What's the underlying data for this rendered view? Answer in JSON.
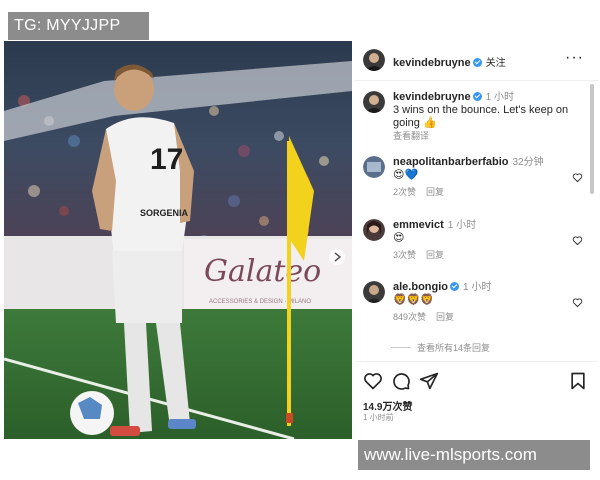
{
  "watermark_top": "TG: MYYJJPP",
  "watermark_bottom": "www.live-mlsports.com",
  "photo": {
    "jersey_number": "17",
    "sponsor_text": "SORGENIA",
    "banner_text": "Galateo",
    "banner_subtext": "ACCESSORIES & DESIGN · MILANO"
  },
  "post": {
    "username": "kevindebruyne",
    "follow_label": "关注",
    "more_label": "···",
    "caption_user": "kevindebruyne",
    "caption_time": "1 小时",
    "caption_text": "3 wins on the bounce. Let's keep on going",
    "caption_emoji": "👍",
    "see_translation": "查看翻译"
  },
  "comments": [
    {
      "user": "neapolitanbarberfabio",
      "time": "32分钟",
      "text": "😍💙",
      "likes": "2次赞",
      "reply": "回复"
    },
    {
      "user": "emmevict",
      "time": "1 小时",
      "text": "😍",
      "likes": "3次赞",
      "reply": "回复"
    },
    {
      "user": "ale.bongio",
      "time": "1 小时",
      "text": "🦁🦁🦁",
      "likes": "849次赞",
      "reply": "回复"
    }
  ],
  "view_all_replies": "查看所有14条回复",
  "likes_count": "14.9万次赞",
  "posted_time": "1 小时前",
  "icons": [
    "heart-icon",
    "comment-icon",
    "share-icon",
    "bookmark-icon",
    "more-icon",
    "verified-icon"
  ],
  "colors": {
    "verified": "#3897f0",
    "watermark_bg": "#8c8c8c",
    "meta_text": "#8e8e8e"
  }
}
